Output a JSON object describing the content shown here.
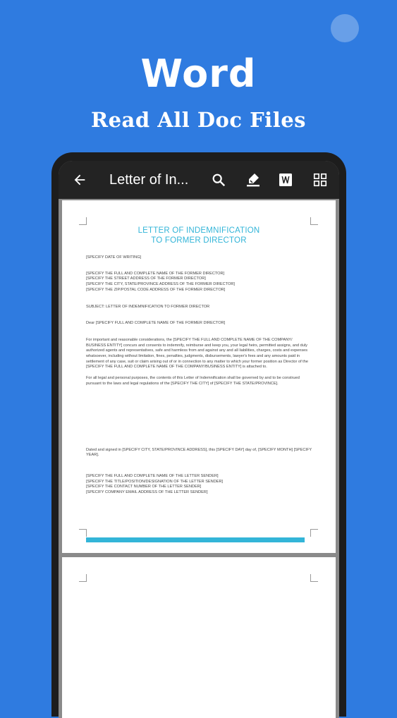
{
  "promo": {
    "headline": "Word",
    "subline": "Read All Doc Files"
  },
  "appbar": {
    "title": "Letter of In...",
    "icons": [
      "back-arrow-icon",
      "search-icon",
      "highlighter-icon",
      "word-file-icon",
      "grid-icon"
    ]
  },
  "colors": {
    "background": "#2f7be0",
    "appbar": "#232323",
    "accent": "#33b5d8"
  },
  "document": {
    "title_line1": "LETTER OF INDEMNIFICATION",
    "title_line2": "TO FORMER DIRECTOR",
    "date": "[SPECIFY DATE OF WRITING]",
    "address": [
      "[SPECIFY THE FULL AND COMPLETE NAME OF THE FORMER DIRECTOR]",
      "[SPECIFY THE STREET ADDRESS OF THE FORMER DIRECTOR]",
      "[SPECIFY THE CITY, STATE/PROVINCE ADDRESS OF THE FORMER DIRECTOR]",
      "[SPECIFY THE ZIP/POSTAL CODE ADDRESS OF THE FORMER DIRECTOR]"
    ],
    "subject": "SUBJECT: LETTER OF INDEMNIFICATION TO FORMER DIRECTOR",
    "salutation": "Dear [SPECIFY FULL AND COMPLETE NAME OF THE FORMER DIRECTOR]",
    "paragraph1": "For important and reasonable considerations, the [SPECIFY THE FULL AND COMPLETE NAME OF THE COMPANY/ BUSINESS ENTITY] concurs and consents to indemnify, reimburse and keep you, your legal heirs, permitted assigns, and duly authorized agents and representatives, safe and harmless from and against any and all liabilities, charges, costs and expenses whatsoever, including without limitation, fines, penalties, judgments, disbursements, lawyer's fees and any amounts paid in settlement of any case, suit or claim arising out of or in connection to any matter to which your former position as Director of the [SPECIFY THE FULL AND COMPLETE NAME OF THE COMPANY/BUSINESS ENTITY] is attached to.",
    "paragraph2": "For all legal and personal purposes, the contents of this Letter of Indemnification shall be governed by and to be construed pursuant to the laws and legal regulations of the [SPECIFY THE CITY] of [SPECIFY THE STATE/PROVINCE].",
    "dated": "Dated and signed in [SPECIFY CITY, STATE/PROVINCE ADDRESS], this [SPECIFY DAY] day of, [SPECIFY MONTH] [SPECIFY YEAR].",
    "sender": [
      "[SPECIFY THE FULL AND COMPLETE NAME OF THE LETTER SENDER]",
      "[SPECIFY THE TITLE/POSITION/DESIGNATION OF THE LETTER SENDER]",
      "[SPECIFY THE CONTACT NUMBER OF THE LETTER SENDER]",
      "[SPECIFY COMPANY EMAIL ADDRESS OF THE LETTER SENDER]"
    ]
  }
}
